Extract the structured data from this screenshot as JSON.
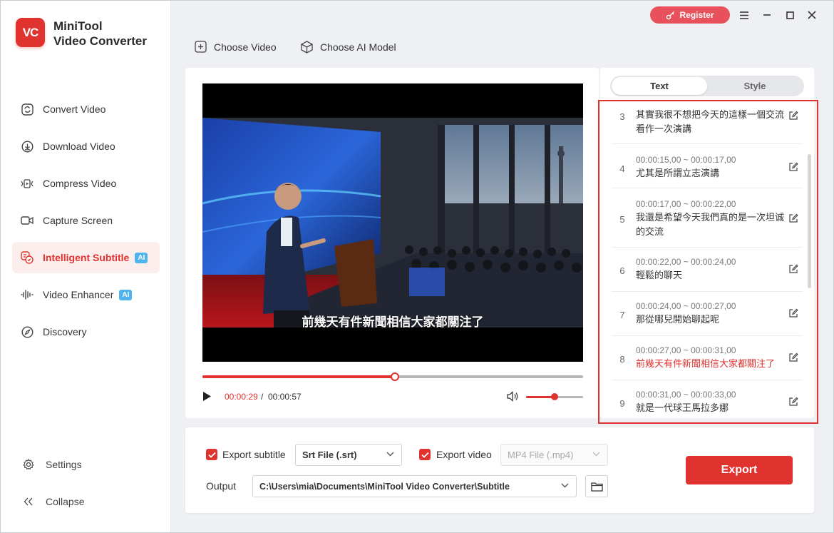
{
  "app": {
    "logo_text": "VC",
    "title_line1": "MiniTool",
    "title_line2": "Video Converter"
  },
  "titlebar": {
    "register_label": "Register"
  },
  "sidebar": {
    "items": [
      {
        "label": "Convert Video",
        "icon": "convert-icon",
        "active": false
      },
      {
        "label": "Download Video",
        "icon": "download-icon",
        "active": false
      },
      {
        "label": "Compress Video",
        "icon": "compress-icon",
        "active": false
      },
      {
        "label": "Capture Screen",
        "icon": "camera-icon",
        "active": false
      },
      {
        "label": "Intelligent Subtitle",
        "icon": "subtitle-icon",
        "active": true,
        "badge": "AI"
      },
      {
        "label": "Video Enhancer",
        "icon": "waveform-icon",
        "active": false,
        "badge": "AI"
      },
      {
        "label": "Discovery",
        "icon": "compass-icon",
        "active": false
      }
    ],
    "settings_label": "Settings",
    "collapse_label": "Collapse"
  },
  "toolbar": {
    "choose_video": "Choose Video",
    "choose_ai_model": "Choose AI Model"
  },
  "player": {
    "subtitle": "前幾天有件新聞相信大家都關注了",
    "current_time": "00:00:29",
    "separator": "/",
    "total_time": "00:00:57",
    "progress": 0.505,
    "volume": 0.5
  },
  "tabs": {
    "text": "Text",
    "style": "Style"
  },
  "subtitles": [
    {
      "num": "3",
      "time": "",
      "text": "其實我很不想把今天的這樣一個交流看作一次演講",
      "highlight": false
    },
    {
      "num": "4",
      "time": "00:00:15,00 ~ 00:00:17,00",
      "text": "尤其是所謂立志演講",
      "highlight": false
    },
    {
      "num": "5",
      "time": "00:00:17,00 ~ 00:00:22,00",
      "text": "我還是希望今天我們真的是一次坦诚的交流",
      "highlight": false
    },
    {
      "num": "6",
      "time": "00:00:22,00 ~ 00:00:24,00",
      "text": "輕鬆的聊天",
      "highlight": false
    },
    {
      "num": "7",
      "time": "00:00:24,00 ~ 00:00:27,00",
      "text": "那從哪兒開始聊起呢",
      "highlight": false
    },
    {
      "num": "8",
      "time": "00:00:27,00 ~ 00:00:31,00",
      "text": "前幾天有件新聞相信大家都關注了",
      "highlight": true
    },
    {
      "num": "9",
      "time": "00:00:31,00 ~ 00:00:33,00",
      "text": "就是一代球王馬拉多娜",
      "highlight": false
    }
  ],
  "export": {
    "export_subtitle_label": "Export subtitle",
    "subtitle_format": "Srt File (.srt)",
    "export_video_label": "Export video",
    "video_format": "MP4 File (.mp4)",
    "output_label": "Output",
    "output_path": "C:\\Users\\mia\\Documents\\MiniTool Video Converter\\Subtitle",
    "export_button": "Export"
  },
  "colors": {
    "accent": "#e0322f",
    "register": "#e8505b",
    "ai_badge": "#4fb3ef"
  }
}
